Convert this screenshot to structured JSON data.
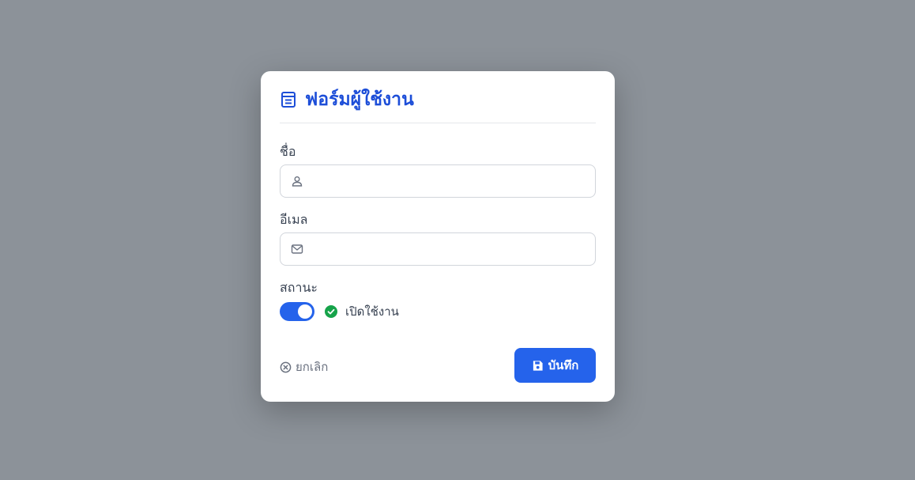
{
  "dialog": {
    "title": "ฟอร์มผู้ใช้งาน",
    "title_icon": "form-icon"
  },
  "fields": {
    "name": {
      "label": "ชื่อ",
      "value": "",
      "placeholder": "",
      "icon": "user-icon"
    },
    "email": {
      "label": "อีเมล",
      "value": "",
      "placeholder": "",
      "icon": "mail-icon"
    }
  },
  "status": {
    "label": "สถานะ",
    "toggle_on": true,
    "text": "เปิดใช้งาน",
    "icon": "check-circle-icon"
  },
  "actions": {
    "cancel_label": "ยกเลิก",
    "cancel_icon": "x-circle-icon",
    "save_label": "บันทึก",
    "save_icon": "floppy-disk-icon"
  },
  "colors": {
    "primary": "#2563eb",
    "title": "#1d4ed8",
    "success": "#16a34a",
    "backdrop": "#8c9299"
  }
}
